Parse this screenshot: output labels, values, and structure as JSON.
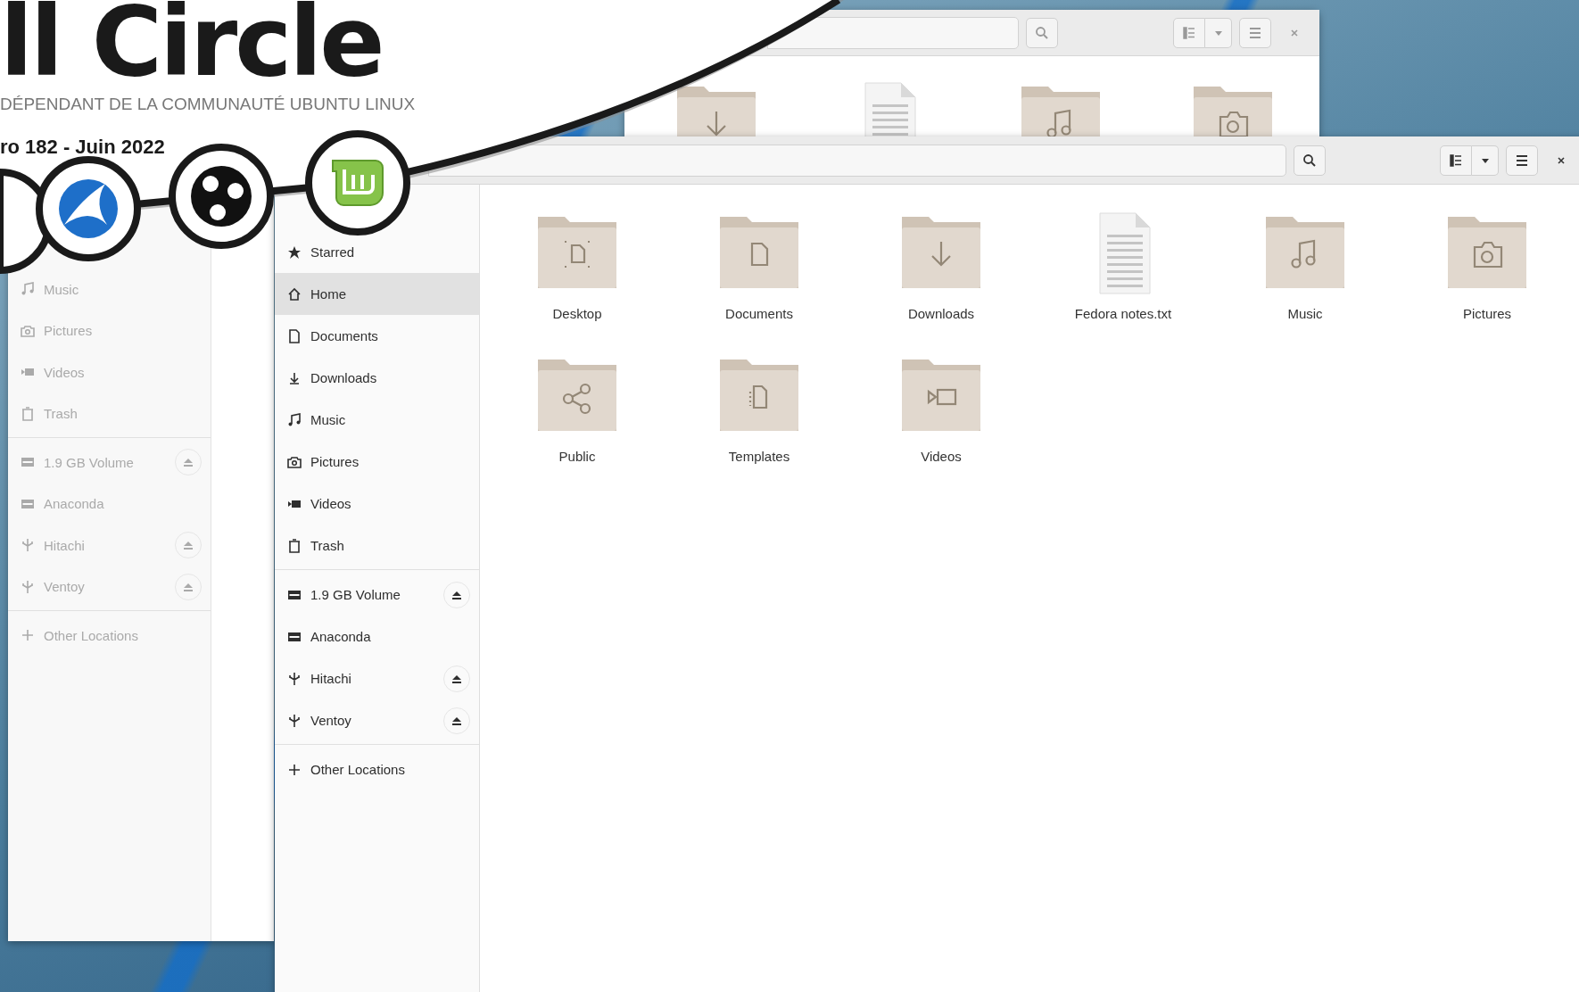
{
  "cover": {
    "title": "ll Circle",
    "subtitle": "DÉPENDANT DE LA COMMUNAUTÉ UBUNTU LINUX",
    "issue": "ro 182 - Juin 2022"
  },
  "back_window": {
    "active": false,
    "files": [
      {
        "kind": "downloads"
      },
      {
        "kind": "text"
      },
      {
        "kind": "music"
      },
      {
        "kind": "pictures"
      }
    ]
  },
  "left_window": {
    "active": false,
    "sidebar": [
      [
        {
          "label": "Music",
          "kind": "music",
          "selected": false,
          "eject": false
        },
        {
          "label": "Pictures",
          "kind": "pictures",
          "selected": false,
          "eject": false
        },
        {
          "label": "Videos",
          "kind": "videos",
          "selected": false,
          "eject": false
        },
        {
          "label": "Trash",
          "kind": "trash",
          "selected": false,
          "eject": false
        }
      ],
      [
        {
          "label": "1.9 GB Volume",
          "kind": "drive",
          "selected": false,
          "eject": true
        },
        {
          "label": "Anaconda",
          "kind": "drive",
          "selected": false,
          "eject": false
        },
        {
          "label": "Hitachi",
          "kind": "usb",
          "selected": false,
          "eject": true
        },
        {
          "label": "Ventoy",
          "kind": "usb",
          "selected": false,
          "eject": true
        }
      ],
      [
        {
          "label": "Other Locations",
          "kind": "plus",
          "selected": false,
          "eject": false
        }
      ]
    ]
  },
  "main_window": {
    "active": true,
    "sidebar": [
      [
        {
          "label": "Starred",
          "kind": "star",
          "selected": false,
          "eject": false
        },
        {
          "label": "Home",
          "kind": "home",
          "selected": true,
          "eject": false
        },
        {
          "label": "Documents",
          "kind": "documents",
          "selected": false,
          "eject": false
        },
        {
          "label": "Downloads",
          "kind": "downloads",
          "selected": false,
          "eject": false
        },
        {
          "label": "Music",
          "kind": "music",
          "selected": false,
          "eject": false
        },
        {
          "label": "Pictures",
          "kind": "pictures",
          "selected": false,
          "eject": false
        },
        {
          "label": "Videos",
          "kind": "videos",
          "selected": false,
          "eject": false
        },
        {
          "label": "Trash",
          "kind": "trash",
          "selected": false,
          "eject": false
        }
      ],
      [
        {
          "label": "1.9 GB Volume",
          "kind": "drive",
          "selected": false,
          "eject": true
        },
        {
          "label": "Anaconda",
          "kind": "drive",
          "selected": false,
          "eject": false
        },
        {
          "label": "Hitachi",
          "kind": "usb",
          "selected": false,
          "eject": true
        },
        {
          "label": "Ventoy",
          "kind": "usb",
          "selected": false,
          "eject": true
        }
      ],
      [
        {
          "label": "Other Locations",
          "kind": "plus",
          "selected": false,
          "eject": false
        }
      ]
    ],
    "files": [
      {
        "name": "Desktop",
        "kind": "desktop"
      },
      {
        "name": "Documents",
        "kind": "documents"
      },
      {
        "name": "Downloads",
        "kind": "downloads"
      },
      {
        "name": "Fedora notes.txt",
        "kind": "text"
      },
      {
        "name": "Music",
        "kind": "music"
      },
      {
        "name": "Pictures",
        "kind": "pictures"
      },
      {
        "name": "Public",
        "kind": "public"
      },
      {
        "name": "Templates",
        "kind": "templates"
      },
      {
        "name": "Videos",
        "kind": "videos"
      }
    ]
  }
}
